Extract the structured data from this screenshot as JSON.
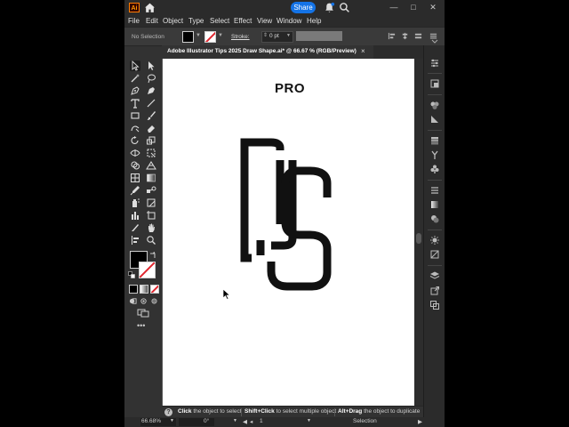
{
  "app": {
    "logo": "Ai"
  },
  "titlebar": {
    "share_label": "Share"
  },
  "menu": [
    "File",
    "Edit",
    "Object",
    "Type",
    "Select",
    "Effect",
    "View",
    "Window",
    "Help"
  ],
  "control_bar": {
    "selection_label": "No Selection",
    "stroke_label": "Stroke:",
    "stroke_value": "0 pt"
  },
  "document": {
    "tab_title": "Adobe Illustrator Tips 2025 Draw Shape.ai* @ 66.67 % (RGB/Preview)",
    "close_label": "×"
  },
  "artboard": {
    "heading": "PRO"
  },
  "hint_bar": {
    "help_icon": "?",
    "click_key": "Click",
    "click_text": " the object to select",
    "shift_key": "Shift+Click",
    "shift_text": " to select multiple object",
    "alt_key": "Alt+Drag",
    "alt_text": " the object to duplicate"
  },
  "status_bar": {
    "zoom": "66.68%",
    "rotation": "0°",
    "artboard_number": "1",
    "tool_name": "Selection"
  },
  "colors": {
    "fill": "#000000",
    "stroke": "none",
    "accent": "#1473e6",
    "logo_stroke": "#111111"
  }
}
